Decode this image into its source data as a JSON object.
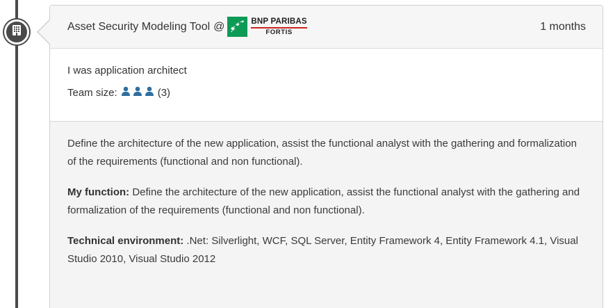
{
  "colors": {
    "timeline": "#4a4a4a",
    "card_border": "#cfcfcf",
    "header_bg": "#f6f6f6",
    "details_bg": "#f4f4f4",
    "person_icon": "#2f6fa0",
    "bnp_green": "#0d9a55",
    "bnp_red": "#cc2222"
  },
  "timeline": {
    "node_icon": "building-icon"
  },
  "experience": {
    "title": "Asset Security Modeling Tool",
    "at": "@",
    "company_logo": {
      "name": "BNP PARIBAS",
      "sub": "FORTIS",
      "icon": "bnp-stars-icon"
    },
    "duration": "1 months",
    "role": "I was application architect",
    "team_label": "Team size:",
    "team_icon": "person-icon",
    "team_icon_count": 3,
    "team_count": "(3)",
    "description": "Define the architecture of the new application, assist the functional analyst with the gathering and formalization of the requirements (functional and non functional).",
    "function_label": "My function:",
    "function_text": " Define the architecture of the new application, assist the functional analyst with the gathering and formalization of the requirements (functional and non functional).",
    "tech_label": "Technical environment:",
    "tech_text": " .Net: Silverlight, WCF, SQL Server, Entity Framework 4, Entity Framework 4.1, Visual Studio 2010, Visual Studio 2012"
  }
}
